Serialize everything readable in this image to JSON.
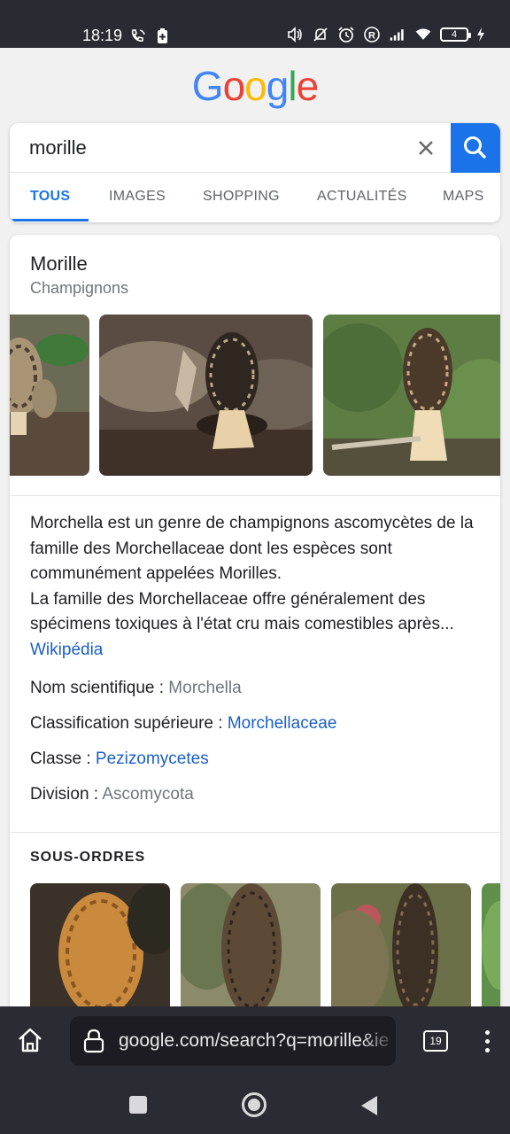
{
  "status_bar": {
    "time": "18:19",
    "battery_level": "4",
    "icons": [
      "phone-call-icon",
      "battery-saver-icon",
      "volume-icon",
      "do-not-disturb-icon",
      "alarm-icon",
      "r-icon",
      "signal-icon",
      "wifi-icon",
      "battery-icon",
      "charging-icon"
    ]
  },
  "logo": {
    "letters": [
      "G",
      "o",
      "o",
      "g",
      "l",
      "e"
    ],
    "colors": [
      "#4285F4",
      "#EA4335",
      "#FBBC05",
      "#4285F4",
      "#34A853",
      "#EA4335"
    ]
  },
  "search": {
    "query": "morille",
    "clear_icon": "close-icon",
    "submit_icon": "search-icon"
  },
  "tabs": [
    {
      "label": "TOUS",
      "active": true
    },
    {
      "label": "IMAGES",
      "active": false
    },
    {
      "label": "SHOPPING",
      "active": false
    },
    {
      "label": "ACTUALITÉS",
      "active": false
    },
    {
      "label": "MAPS",
      "active": false
    }
  ],
  "knowledge": {
    "title": "Morille",
    "subtitle": "Champignons",
    "description_1": "Morchella est un genre de champignons ascomycètes de la famille des Morchellaceae dont les espèces sont communément appelées Morilles.",
    "description_2": "La famille des Morchellaceae offre généralement des spécimens toxiques à l'état cru mais comestibles après...",
    "source_link": "Wikipédia",
    "facts": [
      {
        "label": "Nom scientifique : ",
        "value": "Morchella",
        "is_link": false
      },
      {
        "label": "Classification supérieure : ",
        "value": "Morchellaceae",
        "is_link": true
      },
      {
        "label": "Classe : ",
        "value": "Pezizomycetes",
        "is_link": true
      },
      {
        "label": "Division : ",
        "value": "Ascomycota",
        "is_link": false
      }
    ],
    "suborders_heading": "SOUS-ORDRES"
  },
  "browser": {
    "url": "google.com/search?q=morille&ie",
    "tab_count": "19"
  },
  "accent_color": "#1a73e8",
  "link_color": "#1a5fc8"
}
